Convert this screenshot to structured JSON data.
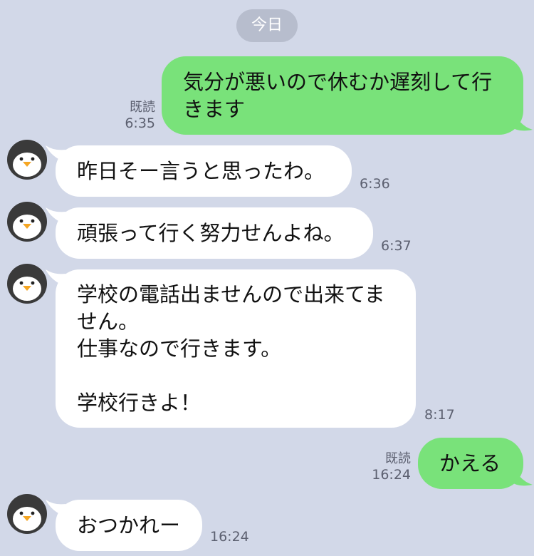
{
  "date_divider": "今日",
  "messages": [
    {
      "text": "気分が悪いので休むか遅刻して行きます",
      "read": "既読",
      "time": "6:35"
    },
    {
      "text": "昨日そー言うと思ったわ。",
      "time": "6:36"
    },
    {
      "text": "頑張って行く努力せんよね。",
      "time": "6:37"
    },
    {
      "text": "学校の電話出ませんので出来てません。\n仕事なので行きます。\n\n学校行きよ！",
      "time": "8:17"
    },
    {
      "text": "かえる",
      "read": "既読",
      "time": "16:24"
    },
    {
      "text": "おつかれー",
      "time": "16:24"
    }
  ],
  "colors": {
    "background": "#d2d8e8",
    "outgoing_bubble": "#79e27a",
    "incoming_bubble": "#ffffff",
    "date_pill": "#b7bdcd"
  }
}
